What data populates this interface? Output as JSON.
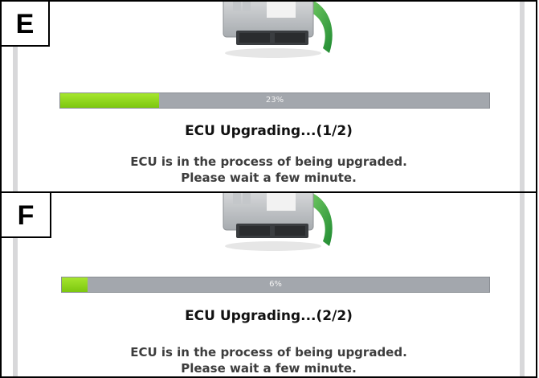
{
  "panels": [
    {
      "step": "E",
      "progress_percent": 23,
      "progress_text": "23%",
      "title": "ECU Upgrading...(1/2)",
      "message_line1": "ECU is in the process of being upgraded.",
      "message_line2": "Please wait a few minute."
    },
    {
      "step": "F",
      "progress_percent": 6,
      "progress_text": "6%",
      "title": "ECU Upgrading...(2/2)",
      "message_line1": "ECU is in the process of being upgraded.",
      "message_line2": "Please wait a few minute."
    }
  ],
  "colors": {
    "progress_fill": "#8ed61a",
    "progress_track": "#a3a7ad",
    "screen_border": "#d8d8da",
    "arrow_green": "#2f9a3a"
  },
  "icons": {
    "ecu": "ecu-module-icon",
    "arrow": "upgrade-arrow-icon"
  }
}
